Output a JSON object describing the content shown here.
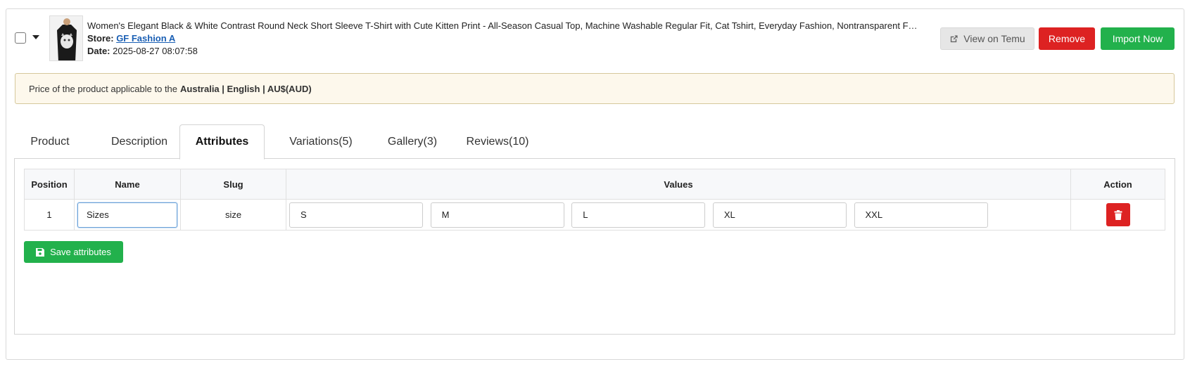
{
  "product": {
    "title": "Women's Elegant Black & White Contrast Round Neck Short Sleeve T-Shirt with Cute Kitten Print - All-Season Casual Top, Machine Washable Regular Fit, Cat Tshirt, Everyday Fashion, Nontransparent Fabric...",
    "store_label": "Store:",
    "store_name": "GF Fashion A",
    "date_label": "Date:",
    "date_value": "2025-08-27 08:07:58"
  },
  "actions": {
    "view_label": "View on Temu",
    "remove_label": "Remove",
    "import_label": "Import Now"
  },
  "notice": {
    "text": "Price of the product applicable to the",
    "region": "Australia | English | AU$(AUD)"
  },
  "tabs": [
    {
      "label": "Product"
    },
    {
      "label": "Description"
    },
    {
      "label": "Attributes"
    },
    {
      "label": "Variations(5)"
    },
    {
      "label": "Gallery(3)"
    },
    {
      "label": "Reviews(10)"
    }
  ],
  "active_tab": "Attributes",
  "table": {
    "headers": {
      "position": "Position",
      "name": "Name",
      "slug": "Slug",
      "values": "Values",
      "action": "Action"
    },
    "rows": [
      {
        "position": "1",
        "name": "Sizes",
        "slug": "size",
        "values": [
          "S",
          "M",
          "L",
          "XL",
          "XXL"
        ]
      }
    ]
  },
  "save_label": "Save attributes",
  "colors": {
    "accent_green": "#22b14c",
    "danger_red": "#dd2222",
    "link_blue": "#1a5fb4",
    "notice_bg": "#fdf8ec"
  }
}
